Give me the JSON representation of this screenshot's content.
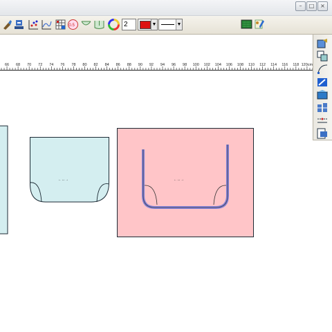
{
  "window": {
    "controls": [
      "–",
      "□",
      "×"
    ]
  },
  "toolbar": {
    "line_width_value": "2",
    "stroke_color": "#dd1111",
    "icons": [
      "brush-icon",
      "stamp-icon",
      "points-icon",
      "curve-icon",
      "grid-icon",
      "measure-icon",
      "offset-icon",
      "notch-icon",
      "seam-icon",
      "color-wheel-icon",
      "color-dropdown",
      "line-style-dropdown",
      "board-icon",
      "tool-settings-icon"
    ]
  },
  "ruler": {
    "unit": "cm",
    "labels": [
      "66",
      "68",
      "70",
      "72",
      "74",
      "76",
      "78",
      "80",
      "82",
      "84",
      "86",
      "88",
      "90",
      "92",
      "94",
      "96",
      "98",
      "100",
      "102",
      "104",
      "106",
      "108",
      "110",
      "112",
      "114",
      "116",
      "118",
      "120cm"
    ]
  },
  "sidebar": {
    "icons": [
      "piece-tool-icon",
      "copy-piece-icon",
      "curve-tool-icon",
      "blue-tool-icon",
      "fill-tool-icon",
      "align-tool-icon",
      "dash-tool-icon",
      "export-icon"
    ]
  },
  "pieces": {
    "left_piece": {
      "fill": "#d4eef0"
    },
    "middle_piece": {
      "fill": "#d4eef0",
      "grain_label": "←↔→"
    },
    "right_piece": {
      "fill": "#ffc5c8",
      "grain_label": "←↔→",
      "inner_outline_color": "#8080d8"
    }
  }
}
